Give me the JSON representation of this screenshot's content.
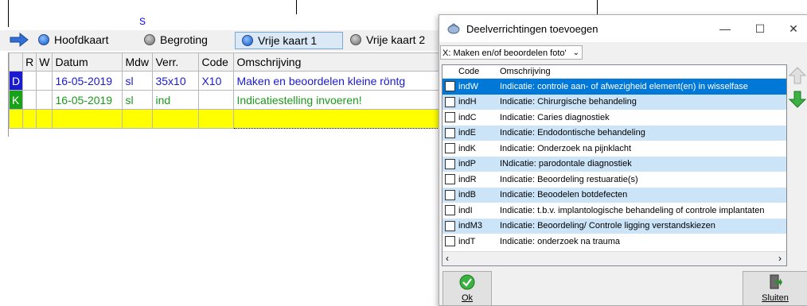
{
  "tooth_strip": {
    "surface": "S"
  },
  "tabs": [
    {
      "label": "Hoofdkaart",
      "active": false
    },
    {
      "label": "Begroting",
      "active": false
    },
    {
      "label": "Vrije kaart 1",
      "active": true
    },
    {
      "label": "Vrije kaart 2",
      "active": false
    }
  ],
  "grid": {
    "headers": [
      "R",
      "W",
      "Datum",
      "Mdw",
      "Verr.",
      "Code",
      "Omschrijving"
    ],
    "rows": [
      {
        "indicator": "D",
        "r": "",
        "w": "",
        "datum": "16-05-2019",
        "mdw": "sl",
        "verr": "35x10",
        "code": "X10",
        "omschrijving": "Maken en beoordelen kleine röntg"
      },
      {
        "indicator": "K",
        "r": "",
        "w": "",
        "datum": "16-05-2019",
        "mdw": "sl",
        "verr": "ind",
        "code": "",
        "omschrijving": "Indicatiestelling invoeren!"
      }
    ]
  },
  "dialog": {
    "title": "Deelverrichtingen toevoegen",
    "dropdown_value": "X: Maken en/of beoordelen foto'",
    "list_headers": {
      "code": "Code",
      "omschrijving": "Omschrijving"
    },
    "items": [
      {
        "code": "indW",
        "text": "Indicatie: controle aan- of afwezigheid element(en) in wisselfase",
        "state": "selected"
      },
      {
        "code": "indH",
        "text": "Indicatie: Chirurgische behandeling",
        "state": "alt"
      },
      {
        "code": "indC",
        "text": "Indicatie: Caries diagnostiek",
        "state": ""
      },
      {
        "code": "indE",
        "text": "Indicatie: Endodontische behandeling",
        "state": "alt"
      },
      {
        "code": "indK",
        "text": "Indicatie: Onderzoek na pijnklacht",
        "state": ""
      },
      {
        "code": "indP",
        "text": "INdicatie: parodontale diagnostiek",
        "state": "alt"
      },
      {
        "code": "indR",
        "text": "Indicatie: Beoordeling restuaratie(s)",
        "state": ""
      },
      {
        "code": "indB",
        "text": "Indicatie: Beoodelen botdefecten",
        "state": "alt"
      },
      {
        "code": "indI",
        "text": "Indicatie: t.b.v. implantologische behandeling of controle implantaten",
        "state": ""
      },
      {
        "code": "indM3",
        "text": "Indicatie: Beoordeling/ Controle ligging verstandskiezen",
        "state": "alt"
      },
      {
        "code": "indT",
        "text": "Indicatie: onderzoek na trauma",
        "state": ""
      }
    ],
    "ok_label": "Ok",
    "sluiten_label": "Sluiten"
  },
  "colors": {
    "selected": "#0078d7",
    "alt_row": "#cce4f7",
    "new_row": "#ffff00",
    "d_indicator": "#1a1acf",
    "k_indicator": "#19a11a"
  }
}
